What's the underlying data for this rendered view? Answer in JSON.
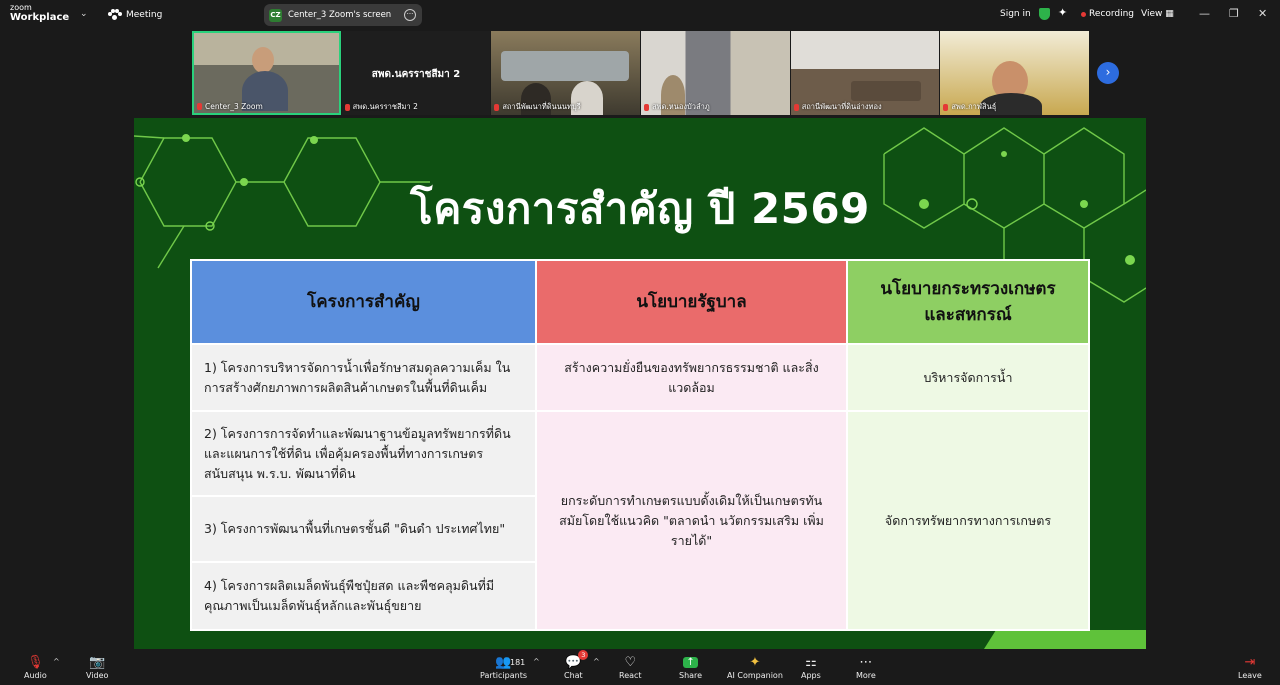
{
  "app": {
    "logo_line1": "zoom",
    "logo_line2": "Workplace",
    "meeting_label": "Meeting"
  },
  "share_pill": {
    "badge": "CZ",
    "label": "Center_3 Zoom's screen"
  },
  "top_right": {
    "sign_in": "Sign in",
    "recording": "Recording",
    "view": "View"
  },
  "thumbnails": [
    {
      "name": "Center_3 Zoom",
      "display": ""
    },
    {
      "name": "สพด.นครราชสีมา 2",
      "display": "สพด.นครราชสีมา 2"
    },
    {
      "name": "สถานีพัฒนาที่ดินนนทบุรี",
      "display": ""
    },
    {
      "name": "สพด.หนองบัวลำภู",
      "display": ""
    },
    {
      "name": "สถานีพัฒนาที่ดินอ่างทอง",
      "display": ""
    },
    {
      "name": "สพด.กาฬสินธุ์",
      "display": ""
    }
  ],
  "slide": {
    "title": "โครงการสำคัญ ปี 2569",
    "headers": [
      "โครงการสำคัญ",
      "นโยบายรัฐบาล",
      "นโยบายกระทรวงเกษตร\nและสหกรณ์"
    ],
    "projects": [
      "1)  โครงการบริหารจัดการน้ำเพื่อรักษาสมดุลความเค็ม ในการสร้างศักยภาพการผลิตสินค้าเกษตรในพื้นที่ดินเค็ม",
      "2)  โครงการการจัดทำและพัฒนาฐานข้อมูลทรัพยากรที่ดิน และแผนการใช้ที่ดิน เพื่อคุ้มครองพื้นที่ทางการเกษตร สนับสนุน พ.ร.บ. พัฒนาที่ดิน",
      "3) โครงการพัฒนาพื้นที่เกษตรชั้นดี \"ดินดำ ประเทศไทย\"",
      "4)  โครงการผลิตเมล็ดพันธุ์พืชปุ๋ยสด และพืชคลุมดินที่มีคุณภาพเป็นเมล็ดพันธุ์หลักและพันธุ์ขยาย"
    ],
    "gov_policy": [
      "สร้างความยั่งยืนของทรัพยากรธรรมชาติ และสิ่งแวดล้อม",
      "ยกระดับการทำเกษตรแบบดั้งเดิมให้เป็นเกษตรทันสมัยโดยใช้แนวคิด \"ตลาดนำ นวัตกรรมเสริม เพิ่มรายได้\""
    ],
    "ministry_policy": [
      "บริหารจัดการน้ำ",
      "จัดการทรัพยากรทางการเกษตร"
    ]
  },
  "toolbar": {
    "audio": "Audio",
    "video": "Video",
    "participants": "Participants",
    "participants_count": "181",
    "chat": "Chat",
    "chat_badge": "3",
    "react": "React",
    "share": "Share",
    "ai": "AI Companion",
    "apps": "Apps",
    "more": "More",
    "leave": "Leave"
  },
  "colors": {
    "accent_green": "#2ad17c",
    "slide_bg": "#0e5012",
    "head_blue": "#5b8fdd",
    "head_red": "#ea6b6b",
    "head_green": "#8ecf63"
  }
}
